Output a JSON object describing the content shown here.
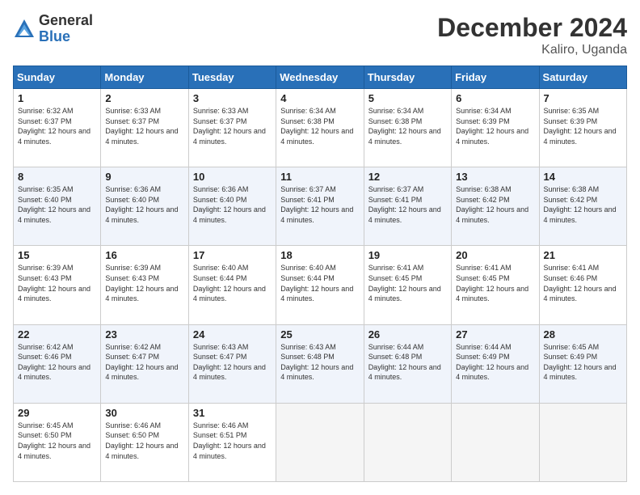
{
  "header": {
    "logo_general": "General",
    "logo_blue": "Blue",
    "main_title": "December 2024",
    "subtitle": "Kaliro, Uganda"
  },
  "calendar": {
    "days_of_week": [
      "Sunday",
      "Monday",
      "Tuesday",
      "Wednesday",
      "Thursday",
      "Friday",
      "Saturday"
    ],
    "weeks": [
      [
        {
          "day": "1",
          "info": "Sunrise: 6:32 AM\nSunset: 6:37 PM\nDaylight: 12 hours and 4 minutes."
        },
        {
          "day": "2",
          "info": "Sunrise: 6:33 AM\nSunset: 6:37 PM\nDaylight: 12 hours and 4 minutes."
        },
        {
          "day": "3",
          "info": "Sunrise: 6:33 AM\nSunset: 6:37 PM\nDaylight: 12 hours and 4 minutes."
        },
        {
          "day": "4",
          "info": "Sunrise: 6:34 AM\nSunset: 6:38 PM\nDaylight: 12 hours and 4 minutes."
        },
        {
          "day": "5",
          "info": "Sunrise: 6:34 AM\nSunset: 6:38 PM\nDaylight: 12 hours and 4 minutes."
        },
        {
          "day": "6",
          "info": "Sunrise: 6:34 AM\nSunset: 6:39 PM\nDaylight: 12 hours and 4 minutes."
        },
        {
          "day": "7",
          "info": "Sunrise: 6:35 AM\nSunset: 6:39 PM\nDaylight: 12 hours and 4 minutes."
        }
      ],
      [
        {
          "day": "8",
          "info": "Sunrise: 6:35 AM\nSunset: 6:40 PM\nDaylight: 12 hours and 4 minutes."
        },
        {
          "day": "9",
          "info": "Sunrise: 6:36 AM\nSunset: 6:40 PM\nDaylight: 12 hours and 4 minutes."
        },
        {
          "day": "10",
          "info": "Sunrise: 6:36 AM\nSunset: 6:40 PM\nDaylight: 12 hours and 4 minutes."
        },
        {
          "day": "11",
          "info": "Sunrise: 6:37 AM\nSunset: 6:41 PM\nDaylight: 12 hours and 4 minutes."
        },
        {
          "day": "12",
          "info": "Sunrise: 6:37 AM\nSunset: 6:41 PM\nDaylight: 12 hours and 4 minutes."
        },
        {
          "day": "13",
          "info": "Sunrise: 6:38 AM\nSunset: 6:42 PM\nDaylight: 12 hours and 4 minutes."
        },
        {
          "day": "14",
          "info": "Sunrise: 6:38 AM\nSunset: 6:42 PM\nDaylight: 12 hours and 4 minutes."
        }
      ],
      [
        {
          "day": "15",
          "info": "Sunrise: 6:39 AM\nSunset: 6:43 PM\nDaylight: 12 hours and 4 minutes."
        },
        {
          "day": "16",
          "info": "Sunrise: 6:39 AM\nSunset: 6:43 PM\nDaylight: 12 hours and 4 minutes."
        },
        {
          "day": "17",
          "info": "Sunrise: 6:40 AM\nSunset: 6:44 PM\nDaylight: 12 hours and 4 minutes."
        },
        {
          "day": "18",
          "info": "Sunrise: 6:40 AM\nSunset: 6:44 PM\nDaylight: 12 hours and 4 minutes."
        },
        {
          "day": "19",
          "info": "Sunrise: 6:41 AM\nSunset: 6:45 PM\nDaylight: 12 hours and 4 minutes."
        },
        {
          "day": "20",
          "info": "Sunrise: 6:41 AM\nSunset: 6:45 PM\nDaylight: 12 hours and 4 minutes."
        },
        {
          "day": "21",
          "info": "Sunrise: 6:41 AM\nSunset: 6:46 PM\nDaylight: 12 hours and 4 minutes."
        }
      ],
      [
        {
          "day": "22",
          "info": "Sunrise: 6:42 AM\nSunset: 6:46 PM\nDaylight: 12 hours and 4 minutes."
        },
        {
          "day": "23",
          "info": "Sunrise: 6:42 AM\nSunset: 6:47 PM\nDaylight: 12 hours and 4 minutes."
        },
        {
          "day": "24",
          "info": "Sunrise: 6:43 AM\nSunset: 6:47 PM\nDaylight: 12 hours and 4 minutes."
        },
        {
          "day": "25",
          "info": "Sunrise: 6:43 AM\nSunset: 6:48 PM\nDaylight: 12 hours and 4 minutes."
        },
        {
          "day": "26",
          "info": "Sunrise: 6:44 AM\nSunset: 6:48 PM\nDaylight: 12 hours and 4 minutes."
        },
        {
          "day": "27",
          "info": "Sunrise: 6:44 AM\nSunset: 6:49 PM\nDaylight: 12 hours and 4 minutes."
        },
        {
          "day": "28",
          "info": "Sunrise: 6:45 AM\nSunset: 6:49 PM\nDaylight: 12 hours and 4 minutes."
        }
      ],
      [
        {
          "day": "29",
          "info": "Sunrise: 6:45 AM\nSunset: 6:50 PM\nDaylight: 12 hours and 4 minutes."
        },
        {
          "day": "30",
          "info": "Sunrise: 6:46 AM\nSunset: 6:50 PM\nDaylight: 12 hours and 4 minutes."
        },
        {
          "day": "31",
          "info": "Sunrise: 6:46 AM\nSunset: 6:51 PM\nDaylight: 12 hours and 4 minutes."
        },
        {
          "day": "",
          "info": ""
        },
        {
          "day": "",
          "info": ""
        },
        {
          "day": "",
          "info": ""
        },
        {
          "day": "",
          "info": ""
        }
      ]
    ]
  }
}
